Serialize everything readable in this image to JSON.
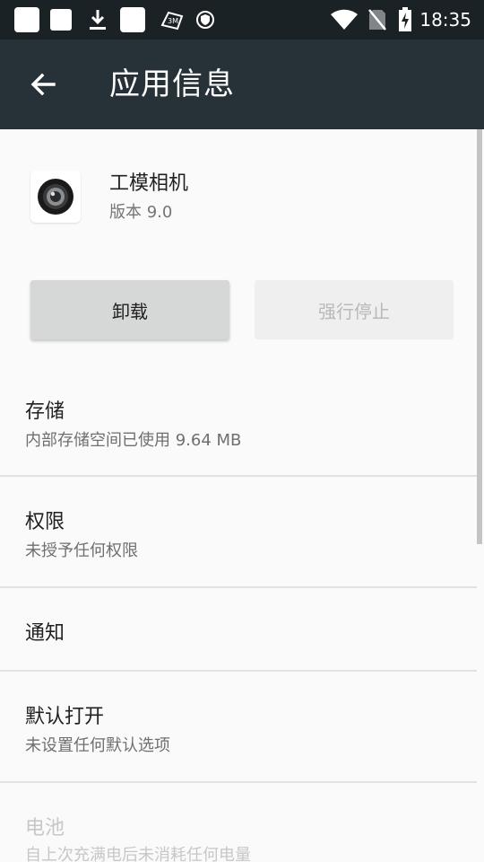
{
  "status_bar": {
    "time": "18:35",
    "icons": [
      "notification-square-icon",
      "notification-square-icon",
      "download-icon",
      "notification-square-icon",
      "app-badge-icon",
      "shield-icon",
      "wifi-icon",
      "no-sim-icon",
      "battery-charging-icon"
    ]
  },
  "toolbar": {
    "back_icon": "arrow-left-icon",
    "title": "应用信息"
  },
  "app": {
    "name": "工模相机",
    "version": "版本 9.0",
    "icon": "camera-lens-icon"
  },
  "buttons": {
    "uninstall": "卸载",
    "force_stop": "强行停止"
  },
  "items": [
    {
      "title": "存储",
      "subtitle": "内部存储空间已使用 9.64 MB",
      "enabled": true
    },
    {
      "title": "权限",
      "subtitle": "未授予任何权限",
      "enabled": true
    },
    {
      "title": "通知",
      "subtitle": "",
      "enabled": true
    },
    {
      "title": "默认打开",
      "subtitle": "未设置任何默认选项",
      "enabled": true
    },
    {
      "title": "电池",
      "subtitle": "自上次充满电后未消耗任何电量",
      "enabled": false
    }
  ],
  "colors": {
    "status_bar": "#1b2226",
    "toolbar": "#263238",
    "background": "#fafafa",
    "divider": "#e2e2e2"
  }
}
